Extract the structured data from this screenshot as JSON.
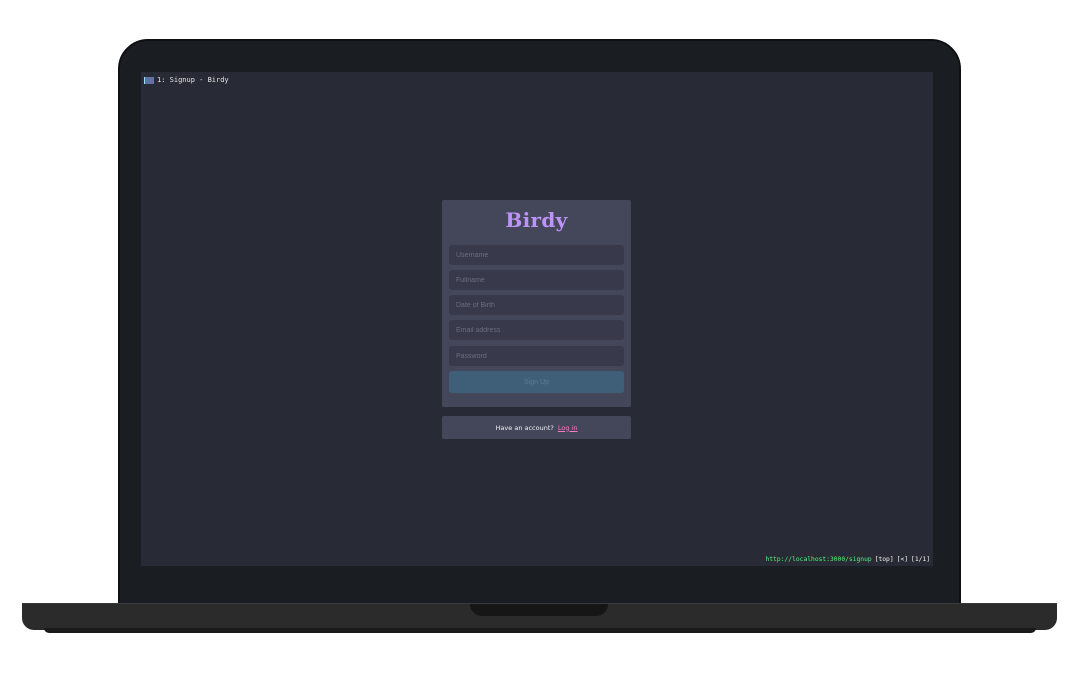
{
  "browser": {
    "tab_title": "1: Signup - Birdy",
    "status": {
      "url": "http://localhost:3000/signup",
      "scroll": "[top]",
      "history": "[<]",
      "tabs": "[1/1]"
    }
  },
  "signup": {
    "brand": "Birdy",
    "fields": {
      "username": {
        "value": "",
        "placeholder": "Username"
      },
      "fullname": {
        "value": "",
        "placeholder": "Fullname"
      },
      "dob": {
        "value": "",
        "placeholder": "Date of Birth"
      },
      "email": {
        "value": "",
        "placeholder": "Email address"
      },
      "password": {
        "value": "",
        "placeholder": "Password"
      }
    },
    "submit_label": "Sign Up"
  },
  "login_prompt": {
    "text": "Have an account?",
    "link_label": "Log in"
  },
  "colors": {
    "background": "#282a36",
    "card": "#44475a",
    "brand": "#bd93f9",
    "link": "#ff79c6",
    "url": "#50fa7b"
  }
}
